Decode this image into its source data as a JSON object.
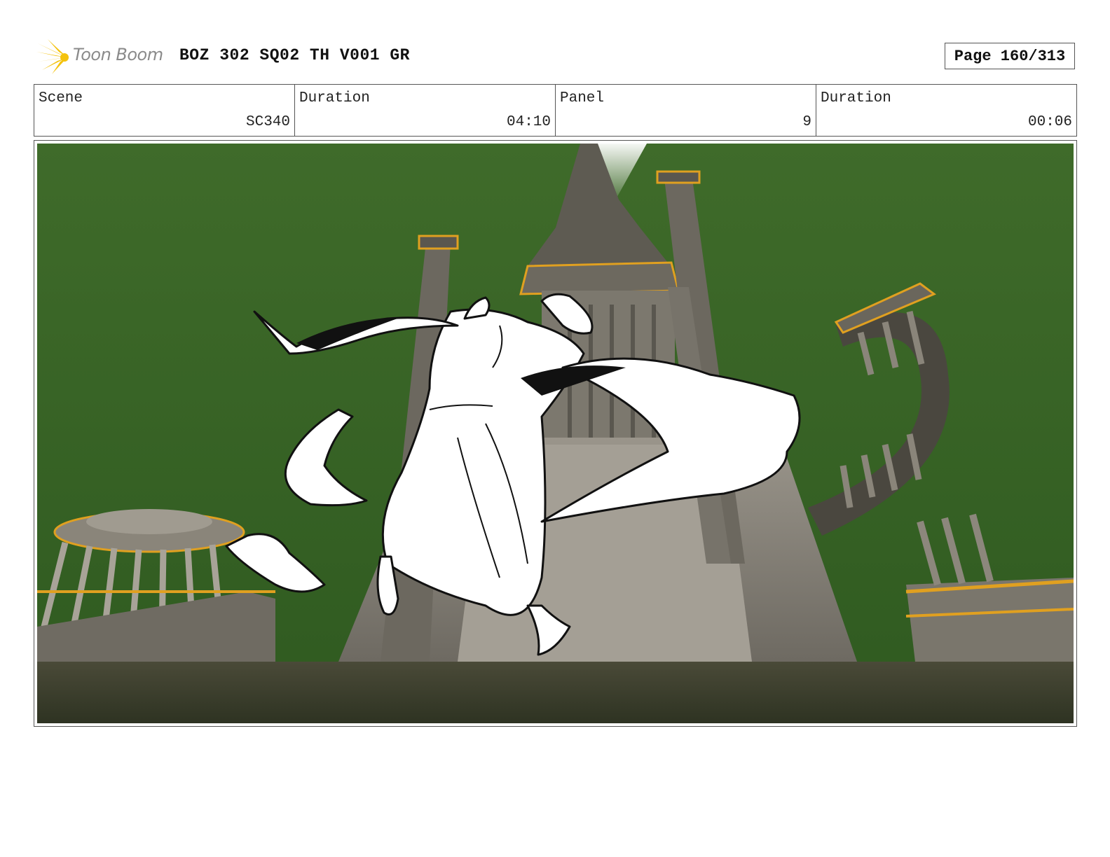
{
  "header": {
    "logo_text": "Toon Boom",
    "doc_title": "BOZ 302 SQ02 TH V001 GR",
    "page_label": "Page 160/313"
  },
  "info": [
    {
      "label": "Scene",
      "value": "SC340"
    },
    {
      "label": "Duration",
      "value": "04:10"
    },
    {
      "label": "Panel",
      "value": "9"
    },
    {
      "label": "Duration",
      "value": "00:06"
    }
  ],
  "panel": {
    "sky_color": "#3f6b2a",
    "stone_color": "#8f8a80",
    "trim_color": "#e0a020"
  }
}
